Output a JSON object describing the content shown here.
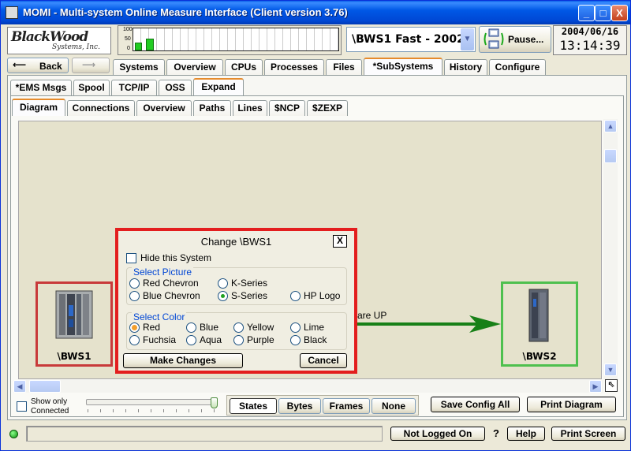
{
  "window": {
    "title": "MOMI - Multi-system Online Measure Interface (Client version 3.76)",
    "min_label": "_",
    "max_label": "□",
    "close_label": "X"
  },
  "toolbar": {
    "logo_line1": "BlackWood",
    "logo_line2": "Systems, Inc.",
    "gauge_ticks": [
      "100",
      "50",
      "0"
    ],
    "gauge_bars": [
      0.35,
      0.55
    ],
    "system_select": "\\BWS1 Fast - 2002",
    "pause_label": "Pause...",
    "date": "2004/06/16",
    "time": "13:14:39",
    "back_label": "Back"
  },
  "main_tabs": [
    "Systems",
    "Overview",
    "CPUs",
    "Processes",
    "Files",
    "*SubSystems",
    "History",
    "Configure"
  ],
  "sub_tabs": [
    "*EMS Msgs",
    "Spool",
    "TCP/IP",
    "OSS",
    "Expand"
  ],
  "expand_tabs": [
    "Diagram",
    "Connections",
    "Overview",
    "Paths",
    "Lines",
    "$NCP",
    "$ZEXP"
  ],
  "diagram": {
    "link_label": "are UP",
    "node1": {
      "name": "\\BWS1",
      "frame_color": "#C83A3A"
    },
    "node2": {
      "name": "\\BWS2",
      "frame_color": "#4EC04E"
    },
    "arrow_color": "#178017"
  },
  "dialog": {
    "title": "Change \\BWS1",
    "close": "X",
    "hide_label": "Hide this System",
    "picture_legend": "Select Picture",
    "picture_options": [
      "Red Chevron",
      "K-Series",
      "Blue Chevron",
      "S-Series",
      "HP Logo"
    ],
    "picture_selected": "S-Series",
    "color_legend": "Select Color",
    "color_options": [
      "Red",
      "Blue",
      "Yellow",
      "Lime",
      "Fuchsia",
      "Aqua",
      "Purple",
      "Black"
    ],
    "color_selected": "Red",
    "make_changes": "Make Changes",
    "cancel": "Cancel"
  },
  "bottom": {
    "show_only": "Show only",
    "connected": "Connected",
    "modes": [
      "States",
      "Bytes",
      "Frames",
      "None"
    ],
    "active_mode": "States",
    "save_config": "Save Config All",
    "print_diagram": "Print Diagram"
  },
  "statusbar": {
    "login": "Not Logged On",
    "question": "?",
    "help": "Help",
    "print_screen": "Print Screen"
  }
}
